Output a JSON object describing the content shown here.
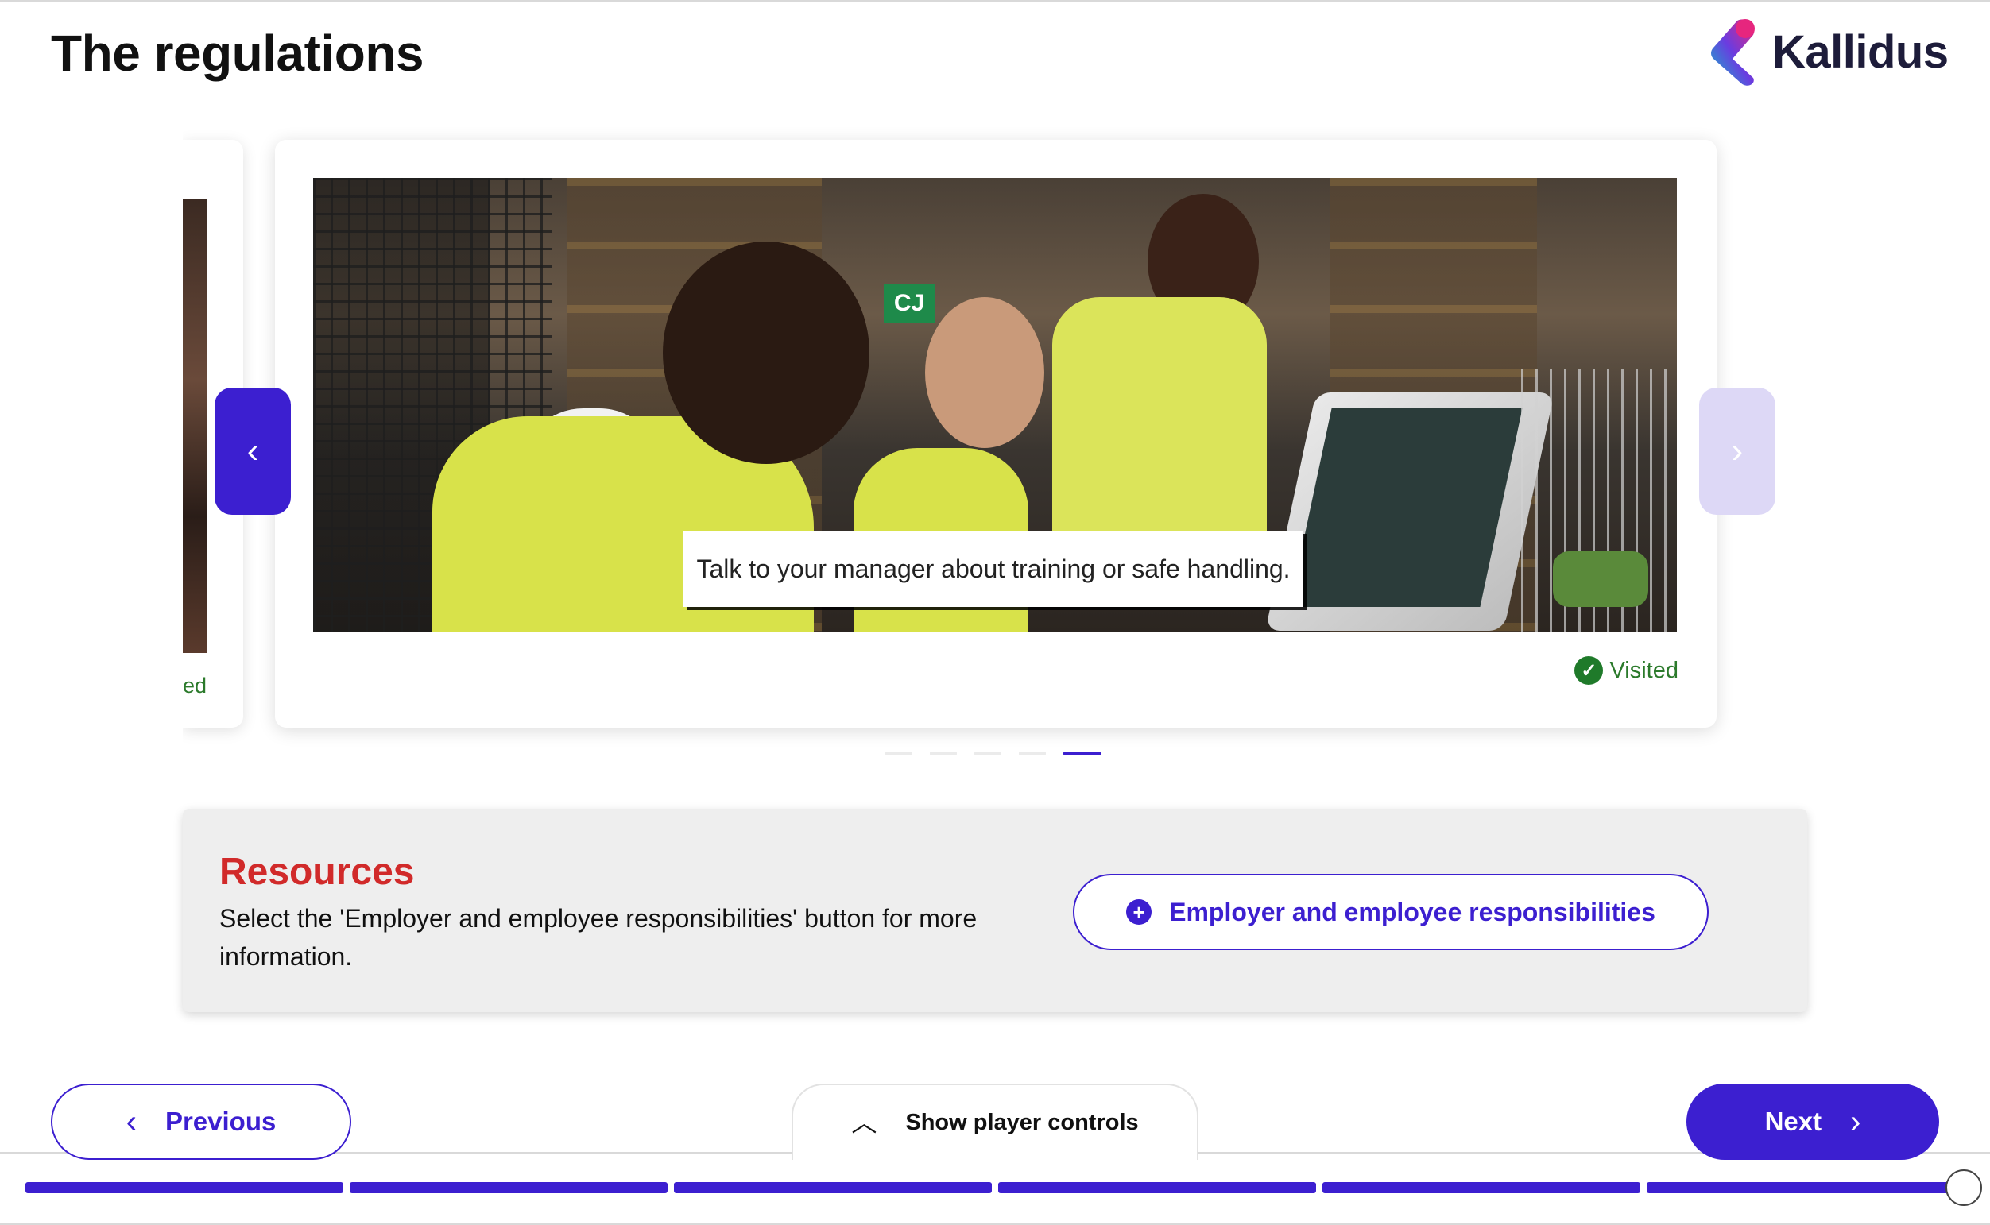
{
  "page": {
    "title": "The regulations"
  },
  "brand": {
    "name": "Kallidus",
    "colors": {
      "accent": "#3c1fd0",
      "pink": "#e6267e",
      "teal": "#12b5c9"
    }
  },
  "carousel": {
    "prev_card_status": "ed",
    "caption": "Talk to your manager about training or safe handling.",
    "visited_label": "Visited",
    "prev_arrow_icon": "chevron-left-icon",
    "next_arrow_icon": "chevron-right-icon",
    "slides_total": 5,
    "active_slide": 5
  },
  "resources": {
    "title": "Resources",
    "text": "Select the 'Employer and employee responsibilities' button for more information.",
    "button_label": "Employer and employee responsibilities"
  },
  "footer": {
    "previous_label": "Previous",
    "next_label": "Next",
    "player_controls_label": "Show player controls",
    "progress_segments": 6,
    "progress_fraction": 1.0
  }
}
